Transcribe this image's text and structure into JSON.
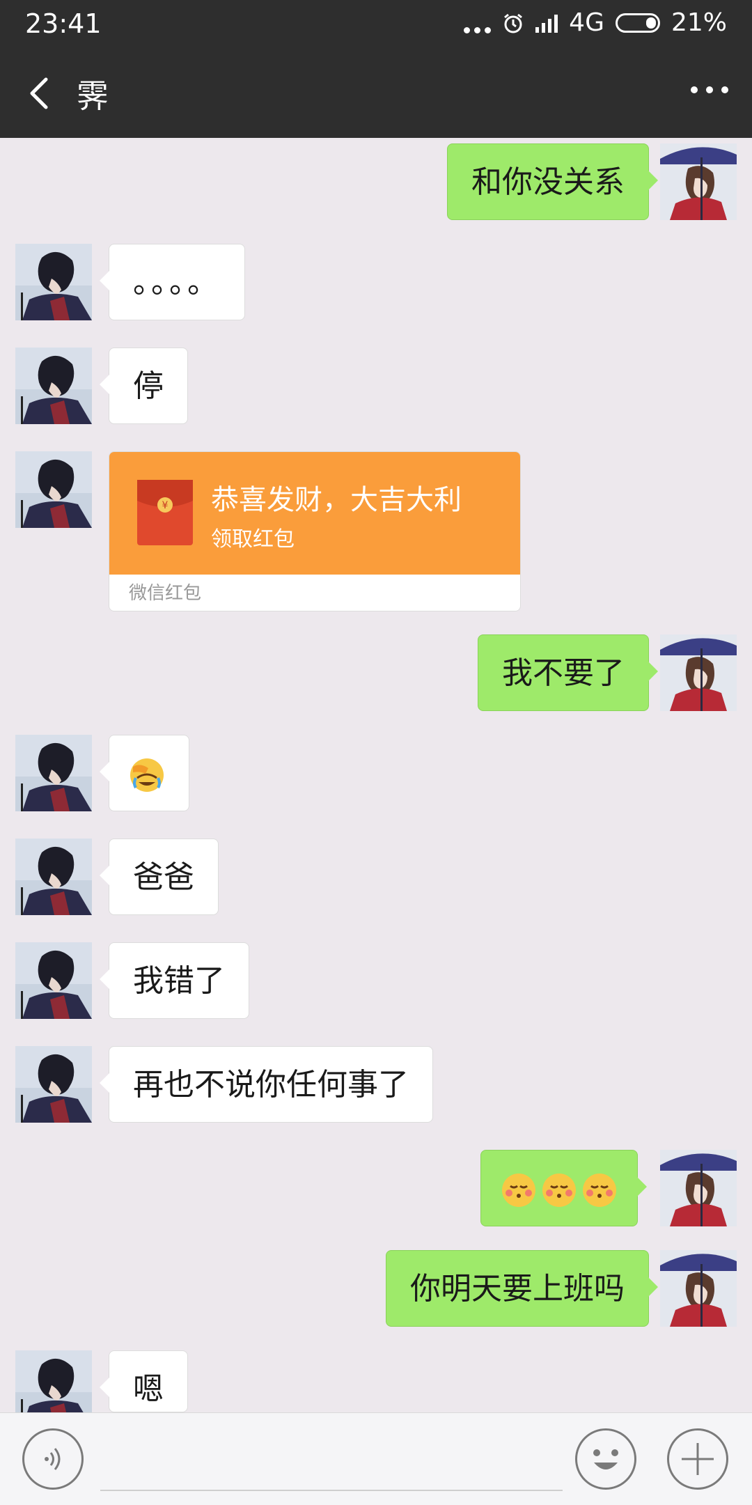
{
  "status_bar": {
    "time": "23:41",
    "network": "4G",
    "battery": "21%"
  },
  "header": {
    "title": "霁"
  },
  "messages": [
    {
      "side": "out",
      "text": "和你没关系"
    },
    {
      "side": "in",
      "text": "。。。。"
    },
    {
      "side": "in",
      "text": "停"
    },
    {
      "side": "in",
      "type": "red_packet",
      "title": "恭喜发财，大吉大利",
      "subtitle": "领取红包",
      "footer": "微信红包"
    },
    {
      "side": "out",
      "text": "我不要了"
    },
    {
      "side": "in",
      "emoji": "face-palm-crying-emoji"
    },
    {
      "side": "in",
      "text": "爸爸"
    },
    {
      "side": "in",
      "text": "我错了"
    },
    {
      "side": "in",
      "text": "再也不说你任何事了"
    },
    {
      "side": "out",
      "emoji": "kissing-face-emoji x3"
    },
    {
      "side": "out",
      "text": "你明天要上班吗"
    },
    {
      "side": "in",
      "text": "嗯"
    }
  ],
  "colors": {
    "topbar": "#2e2e2e",
    "chat_bg": "#ede8ed",
    "outgoing": "#9eea6a",
    "incoming": "#ffffff",
    "red_packet": "#fa9d3b"
  },
  "input": {
    "placeholder": ""
  }
}
